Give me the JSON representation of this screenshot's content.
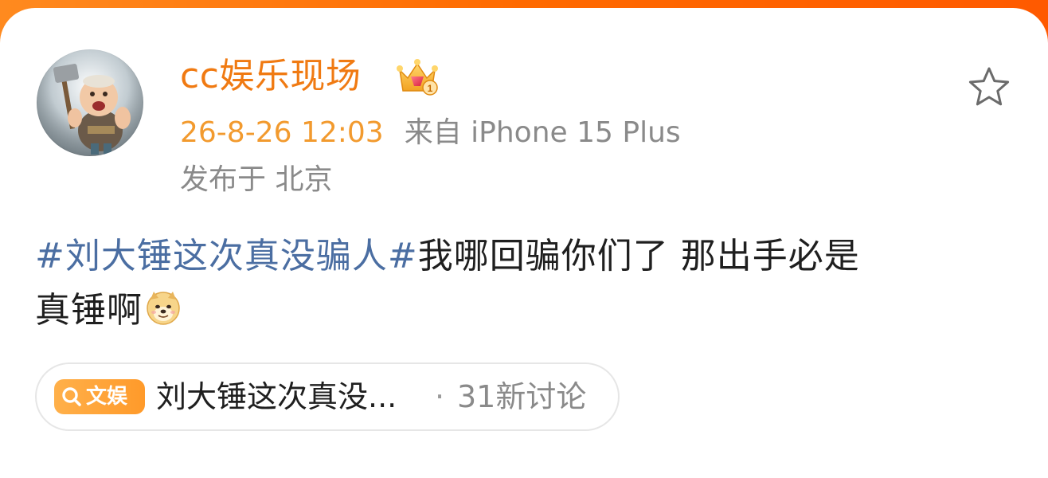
{
  "post": {
    "author": {
      "name": "cc娱乐现场",
      "avatar": "avatar-baby-warrior",
      "badge_icon": "crown-vip-icon",
      "badge_level": "1"
    },
    "meta": {
      "time": "26-8-26 12:03",
      "source": "来自 iPhone 15 Plus",
      "location": "发布于 北京"
    },
    "content": {
      "hashtag": "#刘大锤这次真没骗人#",
      "text_1": "我哪回骗你们了 那出手必是",
      "text_2": "真锤啊",
      "emoji": "doge-emoji"
    },
    "topic": {
      "badge_label": "文娱",
      "badge_icon": "search-icon",
      "title": "刘大锤这次真没...",
      "separator": "·",
      "count": "31新讨论"
    },
    "actions": {
      "favorite_icon": "star-icon"
    }
  },
  "colors": {
    "header_gradient": "#ff6a00",
    "username": "#f07a12",
    "time": "#f29a2e",
    "hashtag": "#4b6ea2",
    "badge": "#ff9a2a"
  }
}
